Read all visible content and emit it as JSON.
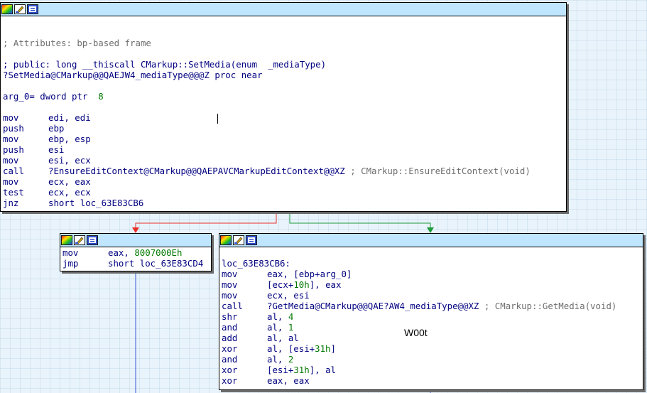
{
  "nodes": {
    "main": {
      "lines": [
        {
          "type": "blank"
        },
        {
          "type": "blank"
        },
        {
          "type": "comment",
          "text": "; Attributes: bp-based frame"
        },
        {
          "type": "blank"
        },
        {
          "type": "comment_blue",
          "text": "; public: long __thiscall CMarkup::SetMedia(enum  _mediaType)"
        },
        {
          "type": "text",
          "text": "?SetMedia@CMarkup@@QAEJW4_mediaType@@@Z proc near"
        },
        {
          "type": "blank"
        },
        {
          "type": "argdef",
          "name": "arg_0",
          "mid": "= dword ptr  ",
          "val": "8"
        },
        {
          "type": "blank"
        },
        {
          "type": "ins",
          "mn": "mov",
          "ops": [
            {
              "t": "edi, edi"
            }
          ]
        },
        {
          "type": "ins",
          "mn": "push",
          "ops": [
            {
              "t": "ebp"
            }
          ]
        },
        {
          "type": "ins",
          "mn": "mov",
          "ops": [
            {
              "t": "ebp, esp"
            }
          ]
        },
        {
          "type": "ins",
          "mn": "push",
          "ops": [
            {
              "t": "esi"
            }
          ]
        },
        {
          "type": "ins",
          "mn": "mov",
          "ops": [
            {
              "t": "esi, ecx"
            }
          ]
        },
        {
          "type": "ins",
          "mn": "call",
          "ops": [
            {
              "t": "?EnsureEditContext@CMarkup@@QAEPAVCMarkupEditContext@@XZ"
            }
          ],
          "comment": " ; CMarkup::EnsureEditContext(void)"
        },
        {
          "type": "ins",
          "mn": "mov",
          "ops": [
            {
              "t": "ecx, eax"
            }
          ]
        },
        {
          "type": "ins",
          "mn": "test",
          "ops": [
            {
              "t": "ecx, ecx"
            }
          ]
        },
        {
          "type": "ins",
          "mn": "jnz",
          "ops": [
            {
              "t": "short loc_63E83CB6"
            }
          ]
        }
      ]
    },
    "left": {
      "lines": [
        {
          "type": "ins",
          "mn": "mov",
          "ops": [
            {
              "t": "eax, "
            },
            {
              "t": "8007000Eh",
              "c": "num"
            }
          ]
        },
        {
          "type": "ins",
          "mn": "jmp",
          "ops": [
            {
              "t": "short loc_63E83CD4"
            }
          ]
        }
      ]
    },
    "right": {
      "lines": [
        {
          "type": "blank"
        },
        {
          "type": "text",
          "text": "loc_63E83CB6:"
        },
        {
          "type": "ins",
          "mn": "mov",
          "ops": [
            {
              "t": "eax, [ebp+"
            },
            {
              "t": "arg_0",
              "c": "argref"
            },
            {
              "t": "]"
            }
          ]
        },
        {
          "type": "ins",
          "mn": "mov",
          "ops": [
            {
              "t": "[ecx+"
            },
            {
              "t": "10h",
              "c": "num"
            },
            {
              "t": "], eax"
            }
          ]
        },
        {
          "type": "ins",
          "mn": "mov",
          "ops": [
            {
              "t": "ecx, esi"
            }
          ]
        },
        {
          "type": "ins",
          "mn": "call",
          "ops": [
            {
              "t": "?GetMedia@CMarkup@@QAE?AW4_mediaType@@XZ"
            }
          ],
          "comment": " ; CMarkup::GetMedia(void)"
        },
        {
          "type": "ins",
          "mn": "shr",
          "ops": [
            {
              "t": "al, "
            },
            {
              "t": "4",
              "c": "num"
            }
          ]
        },
        {
          "type": "ins",
          "mn": "and",
          "ops": [
            {
              "t": "al, "
            },
            {
              "t": "1",
              "c": "num"
            }
          ]
        },
        {
          "type": "ins",
          "mn": "add",
          "ops": [
            {
              "t": "al, al"
            }
          ]
        },
        {
          "type": "ins",
          "mn": "xor",
          "ops": [
            {
              "t": "al, [esi+"
            },
            {
              "t": "31h",
              "c": "num"
            },
            {
              "t": "]"
            }
          ]
        },
        {
          "type": "ins",
          "mn": "and",
          "ops": [
            {
              "t": "al, "
            },
            {
              "t": "2",
              "c": "num"
            }
          ]
        },
        {
          "type": "ins",
          "mn": "xor",
          "ops": [
            {
              "t": "[esi+"
            },
            {
              "t": "31h",
              "c": "num"
            },
            {
              "t": "], al"
            }
          ]
        },
        {
          "type": "ins",
          "mn": "xor",
          "ops": [
            {
              "t": "eax, eax"
            }
          ]
        }
      ]
    }
  },
  "annotation": {
    "text": "W00t"
  },
  "colors": {
    "edge_false": "#e8302a",
    "edge_true": "#1e9a3a",
    "edge_flow": "#3a50d8",
    "titlebar": "#bfe5ff",
    "code_text": "#000080",
    "number": "#007800",
    "comment": "#6e6e6e"
  },
  "titlebar_icons": [
    "graph-color-icon",
    "rename-pencil-icon",
    "graph-overview-icon"
  ]
}
